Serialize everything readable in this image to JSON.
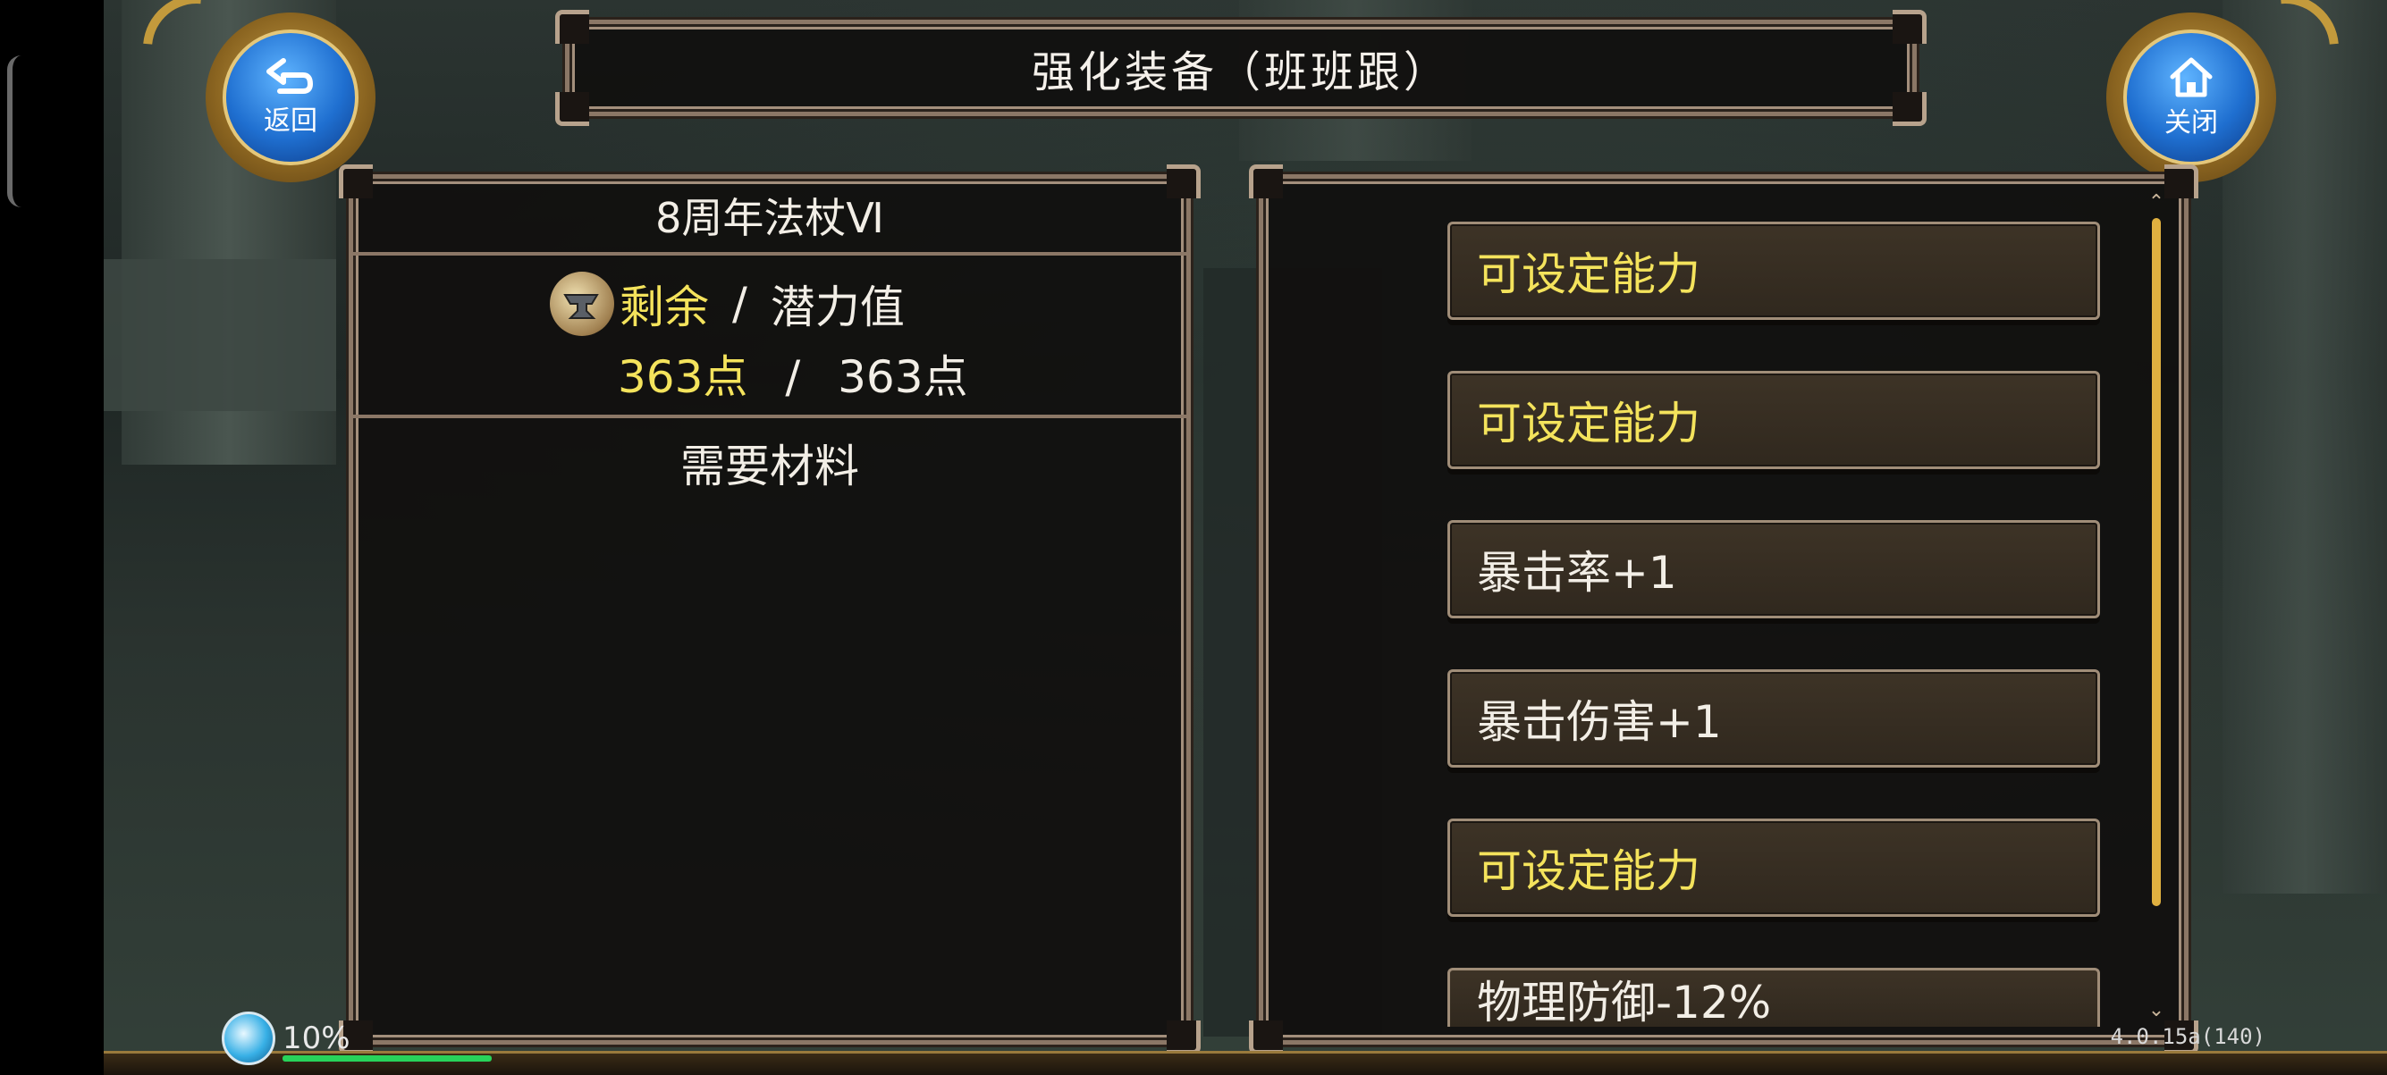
{
  "header": {
    "title": "强化装备（班班跟）"
  },
  "back_button": {
    "label": "返回",
    "icon": "back-arrow-icon"
  },
  "close_button": {
    "label": "关闭",
    "icon": "home-icon"
  },
  "left_panel": {
    "item_name": "8周年法杖Ⅵ",
    "potential_label_remaining": "剩余",
    "potential_separator": "/",
    "potential_label_total": "潜力值",
    "remaining_points": "363点",
    "total_points": "363点",
    "materials_title": "需要材料"
  },
  "right_panel": {
    "abilities": [
      {
        "label": "可设定能力"
      },
      {
        "label": "可设定能力"
      },
      {
        "label": "暴击率+1"
      },
      {
        "label": "暴击伤害+1"
      },
      {
        "label": "可设定能力"
      },
      {
        "label": "物理防御-12%"
      }
    ]
  },
  "status": {
    "percent": "10%",
    "version": "4.0.15a(140)"
  },
  "colors": {
    "accent_yellow": "#f4e35c",
    "frame_border": "#8b7766",
    "scroll_thumb": "#e0b040",
    "button_blue": "#1f6fd0"
  }
}
